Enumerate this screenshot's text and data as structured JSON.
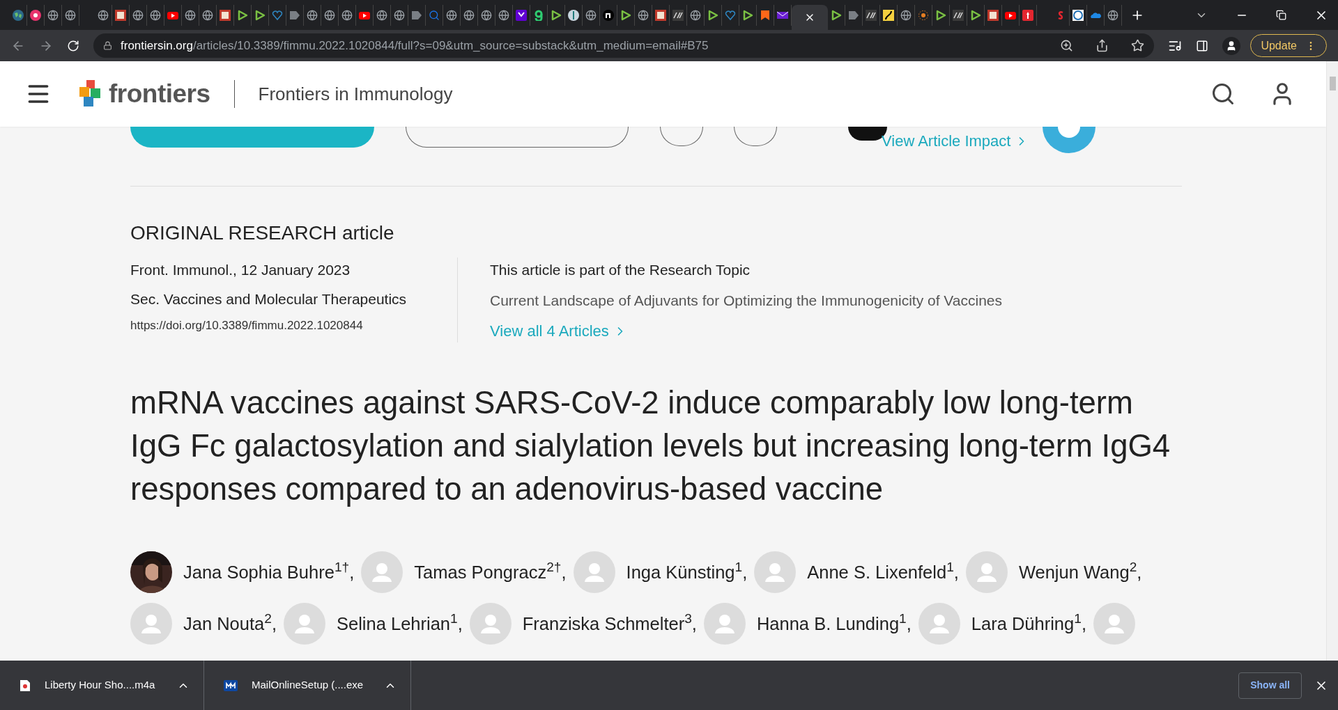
{
  "browser": {
    "tabs": [
      {
        "kind": "earth",
        "selected": false
      },
      {
        "kind": "flower",
        "selected": false
      },
      {
        "kind": "globe",
        "selected": false
      },
      {
        "kind": "globe",
        "selected": false
      },
      {
        "kind": "gap"
      },
      {
        "kind": "globe",
        "selected": false
      },
      {
        "kind": "bi",
        "selected": false
      },
      {
        "kind": "globe",
        "selected": false
      },
      {
        "kind": "globe",
        "selected": false
      },
      {
        "kind": "youtube",
        "selected": false
      },
      {
        "kind": "globe",
        "selected": false
      },
      {
        "kind": "globe",
        "selected": false
      },
      {
        "kind": "bi",
        "selected": false
      },
      {
        "kind": "play",
        "selected": false
      },
      {
        "kind": "play",
        "selected": false
      },
      {
        "kind": "heart",
        "selected": false
      },
      {
        "kind": "arrow",
        "selected": false
      },
      {
        "kind": "globe",
        "selected": false
      },
      {
        "kind": "globe",
        "selected": false
      },
      {
        "kind": "globe",
        "selected": false
      },
      {
        "kind": "youtube",
        "selected": false
      },
      {
        "kind": "globe",
        "selected": false
      },
      {
        "kind": "globe",
        "selected": false
      },
      {
        "kind": "arrow",
        "selected": false
      },
      {
        "kind": "search",
        "selected": false
      },
      {
        "kind": "globe",
        "selected": false
      },
      {
        "kind": "globe",
        "selected": false
      },
      {
        "kind": "globe",
        "selected": false
      },
      {
        "kind": "globe",
        "selected": false
      },
      {
        "kind": "yahoo",
        "selected": false
      },
      {
        "kind": "g",
        "selected": false
      },
      {
        "kind": "play",
        "selected": false
      },
      {
        "kind": "staff",
        "selected": false
      },
      {
        "kind": "globe",
        "selected": false
      },
      {
        "kind": "n",
        "selected": false
      },
      {
        "kind": "play",
        "selected": false
      },
      {
        "kind": "globe",
        "selected": false
      },
      {
        "kind": "bi",
        "selected": false
      },
      {
        "kind": "dr",
        "selected": false
      },
      {
        "kind": "globe",
        "selected": false
      },
      {
        "kind": "play",
        "selected": false
      },
      {
        "kind": "heart",
        "selected": false
      },
      {
        "kind": "play",
        "selected": false
      },
      {
        "kind": "bookmark",
        "selected": false
      },
      {
        "kind": "mail",
        "selected": false
      },
      {
        "kind": "blank",
        "selected": true
      },
      {
        "kind": "play",
        "selected": false
      },
      {
        "kind": "arrow",
        "selected": false
      },
      {
        "kind": "dr",
        "selected": false
      },
      {
        "kind": "road",
        "selected": false
      },
      {
        "kind": "globe",
        "selected": false
      },
      {
        "kind": "sun",
        "selected": false
      },
      {
        "kind": "play",
        "selected": false
      },
      {
        "kind": "dr",
        "selected": false
      },
      {
        "kind": "play",
        "selected": false
      },
      {
        "kind": "bi",
        "selected": false
      },
      {
        "kind": "youtube",
        "selected": false
      },
      {
        "kind": "torch",
        "selected": false
      },
      {
        "kind": "gap"
      },
      {
        "kind": "s",
        "selected": false
      },
      {
        "kind": "e",
        "selected": false
      },
      {
        "kind": "cloud",
        "selected": false
      },
      {
        "kind": "globe",
        "selected": false
      }
    ],
    "address": {
      "domain": "frontiersin.org",
      "path": "/articles/10.3389/fimmu.2022.1020844/full?s=09&utm_source=substack&utm_medium=email#B75"
    },
    "update_button": "Update"
  },
  "site_header": {
    "logo": "frontiers",
    "journal": "Frontiers in Immunology"
  },
  "article_tools": {
    "impact_link": "View Article Impact"
  },
  "article": {
    "type_label": "ORIGINAL RESEARCH article",
    "journal_line": "Front. Immunol., 12 January 2023",
    "section": "Sec. Vaccines and Molecular Therapeutics",
    "doi": "https://doi.org/10.3389/fimmu.2022.1020844",
    "topic_intro": "This article is part of the Research Topic",
    "topic_title": "Current Landscape of Adjuvants for Optimizing the Immunogenicity of Vaccines",
    "topic_link": "View all 4 Articles",
    "title": "mRNA vaccines against SARS-CoV-2 induce comparably low long-term IgG Fc galactosylation and sialylation levels but increasing long-term IgG4 responses compared to an adenovirus-based vaccine"
  },
  "authors": [
    [
      {
        "name": "Jana Sophia Buhre$^{1†}$,"
      },
      {
        "kind": "placeholder",
        "name": "Tamas Pongracz$^{2†}$,"
      },
      {
        "kind": "placeholder",
        "name": "Inga Künsting$^{1}$,"
      },
      {
        "kind": "placeholder",
        "name": "Anne S. Lixenfeld$^{1}$,"
      },
      {
        "kind": "placeholder",
        "name": "Wenjun Wang$^{2}$,"
      }
    ],
    [
      {
        "kind": "placeholder",
        "name": "Jan Nouta$^{2}$,"
      },
      {
        "kind": "placeholder",
        "name": "Selina Lehrian$^{1}$,"
      },
      {
        "kind": "placeholder",
        "name": "Franziska Schmelter$^{3}$,"
      },
      {
        "kind": "placeholder",
        "name": "Hanna B. Lunding$^{1}$,"
      },
      {
        "kind": "placeholder",
        "name": "Lara Dühring$^{1}$,"
      },
      {
        "kind": "placeholder"
      }
    ]
  ],
  "downloads": {
    "items": [
      {
        "kind": "audio",
        "name": "Liberty Hour Sho....m4a"
      },
      {
        "kind": "installer",
        "name": "MailOnlineSetup (....exe"
      }
    ],
    "show_all": "Show all"
  }
}
